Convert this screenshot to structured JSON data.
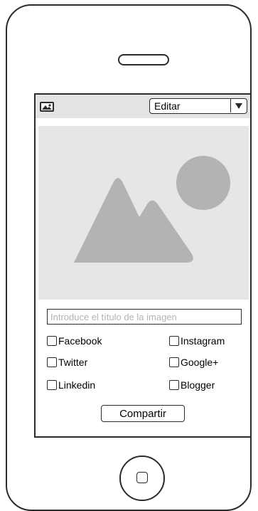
{
  "toolbar": {
    "icon": "image-icon",
    "select": {
      "value": "Editar",
      "icon": "chevron-down-icon"
    }
  },
  "image_placeholder": {
    "icon": "image-placeholder"
  },
  "title_input": {
    "placeholder": "Introduce el título de la imagen",
    "value": ""
  },
  "share_options": [
    {
      "label": "Facebook",
      "checked": false
    },
    {
      "label": "Instagram",
      "checked": false
    },
    {
      "label": "Twitter",
      "checked": false
    },
    {
      "label": "Google+",
      "checked": false
    },
    {
      "label": "Linkedin",
      "checked": false
    },
    {
      "label": "Blogger",
      "checked": false
    }
  ],
  "share_button": {
    "label": "Compartir"
  },
  "colors": {
    "outline": "#2b2b2b",
    "toolbar": "#e3e3e3",
    "placeholder_bg": "#e6e6e6",
    "placeholder_shape": "#b3b3b3"
  }
}
